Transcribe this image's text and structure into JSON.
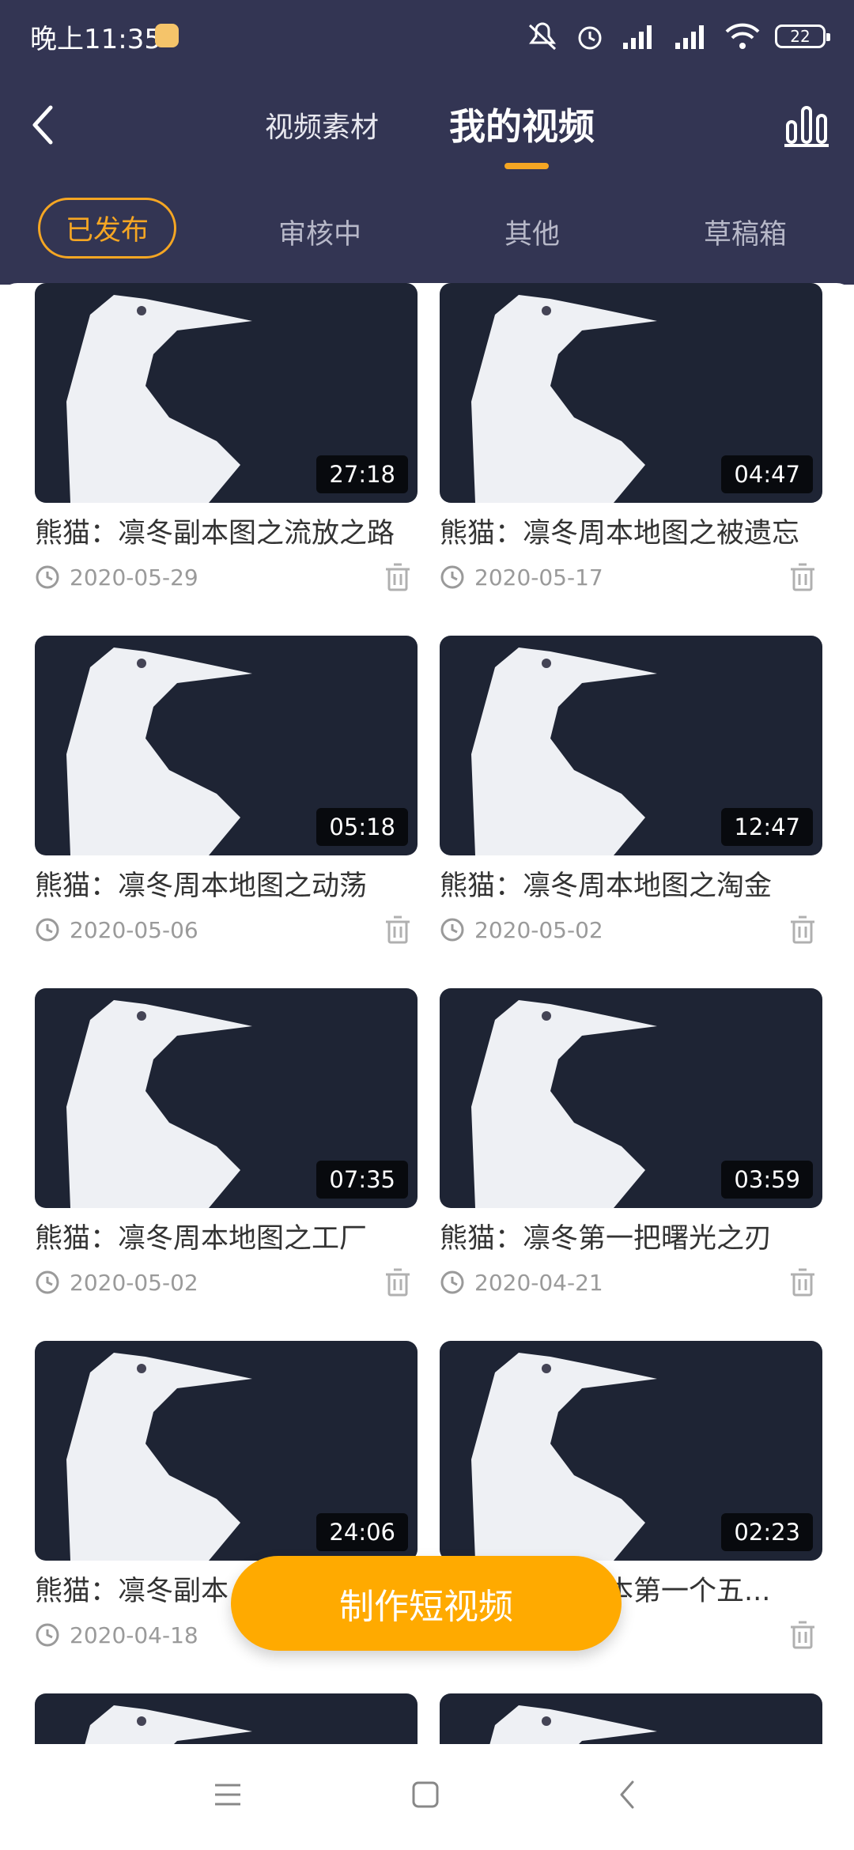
{
  "status_bar": {
    "time": "晚上11:35",
    "battery": "22",
    "icons": [
      "mute-icon",
      "alarm-icon",
      "hd-signal-icon",
      "signal-icon",
      "wifi-icon",
      "battery-icon"
    ]
  },
  "header": {
    "tabs": [
      {
        "label": "视频素材",
        "active": false
      },
      {
        "label": "我的视频",
        "active": true
      }
    ]
  },
  "sub_tabs": [
    {
      "label": "已发布",
      "active": true
    },
    {
      "label": "审核中",
      "active": false
    },
    {
      "label": "其他",
      "active": false
    },
    {
      "label": "草稿箱",
      "active": false
    }
  ],
  "videos": [
    {
      "title": "熊猫：凛冬副本图之流放之路",
      "date": "2020-05-29",
      "duration": "27:18"
    },
    {
      "title": "熊猫：凛冬周本地图之被遗忘",
      "date": "2020-05-17",
      "duration": "04:47"
    },
    {
      "title": "熊猫：凛冬周本地图之动荡",
      "date": "2020-05-06",
      "duration": "05:18"
    },
    {
      "title": "熊猫：凛冬周本地图之淘金",
      "date": "2020-05-02",
      "duration": "12:47"
    },
    {
      "title": "熊猫：凛冬周本地图之工厂",
      "date": "2020-05-02",
      "duration": "07:35"
    },
    {
      "title": "熊猫：凛冬第一把曙光之刃",
      "date": "2020-04-21",
      "duration": "03:59"
    },
    {
      "title": "熊猫：凛冬副本",
      "date": "2020-04-18",
      "duration": "24:06"
    },
    {
      "title": "熊猫：凛冬副本第一个五...",
      "date": "",
      "duration": "02:23"
    }
  ],
  "fab": {
    "label": "制作短视频"
  },
  "colors": {
    "header_bg": "#333553",
    "accent": "#f5a623",
    "fab": "#ffaa00"
  }
}
